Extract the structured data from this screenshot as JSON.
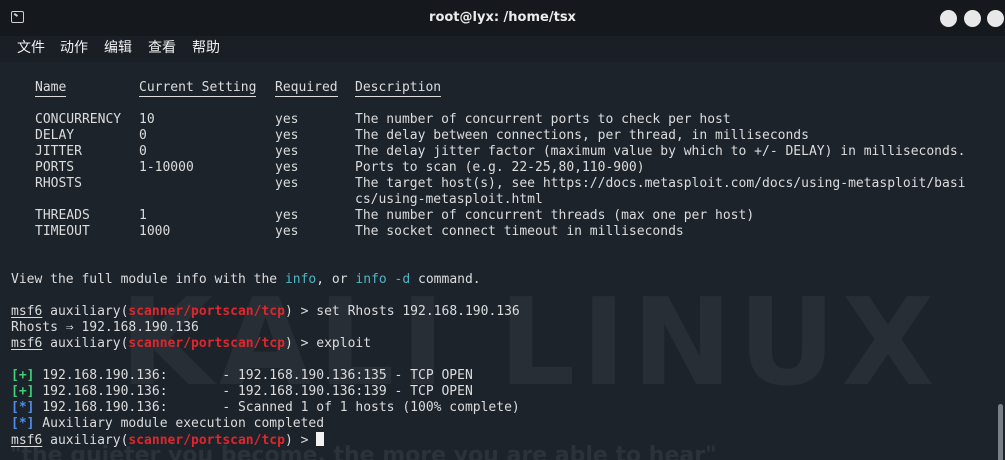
{
  "window": {
    "title": "root@lyx: /home/tsx"
  },
  "menu": [
    "文件",
    "动作",
    "编辑",
    "查看",
    "帮助"
  ],
  "watermark": {
    "big": "KALI LINUX",
    "quote": "\"the quieter you become, the more you are able to hear\""
  },
  "options_table": {
    "headers": [
      "Name",
      "Current Setting",
      "Required",
      "Description"
    ],
    "rows": [
      {
        "name": "CONCURRENCY",
        "setting": "10",
        "required": "yes",
        "description": "The number of concurrent ports to check per host"
      },
      {
        "name": "DELAY",
        "setting": "0",
        "required": "yes",
        "description": "The delay between connections, per thread, in milliseconds"
      },
      {
        "name": "JITTER",
        "setting": "0",
        "required": "yes",
        "description": "The delay jitter factor (maximum value by which to +/- DELAY) in milliseconds."
      },
      {
        "name": "PORTS",
        "setting": "1-10000",
        "required": "yes",
        "description": "Ports to scan (e.g. 22-25,80,110-900)"
      },
      {
        "name": "RHOSTS",
        "setting": "",
        "required": "yes",
        "description": "The target host(s), see https://docs.metasploit.com/docs/using-metasploit/basi",
        "description_cont": "cs/using-metasploit.html"
      },
      {
        "name": "THREADS",
        "setting": "1",
        "required": "yes",
        "description": "The number of concurrent threads (max one per host)"
      },
      {
        "name": "TIMEOUT",
        "setting": "1000",
        "required": "yes",
        "description": "The socket connect timeout in milliseconds"
      }
    ]
  },
  "info_line": {
    "pre": "View the full module info with the ",
    "cmd1": "info",
    "mid": ", or ",
    "cmd2": "info -d",
    "post": " command."
  },
  "prompt": {
    "msf": "msf6",
    "aux": " auxiliary(",
    "module": "scanner/portscan/tcp",
    "end": ") > "
  },
  "commands": [
    "set Rhosts 192.168.190.136",
    "exploit",
    ""
  ],
  "rhosts_echo": "Rhosts ⇒ 192.168.190.136",
  "results": [
    {
      "tag": "[+]",
      "tag_color": "#3fcf7a",
      "text": " 192.168.190.136:       - 192.168.190.136:135 - TCP OPEN"
    },
    {
      "tag": "[+]",
      "tag_color": "#3fcf7a",
      "text": " 192.168.190.136:       - 192.168.190.136:139 - TCP OPEN"
    },
    {
      "tag": "[*]",
      "tag_color": "#4d8fe6",
      "text": " 192.168.190.136:       - Scanned 1 of 1 hosts (100% complete)"
    },
    {
      "tag": "[*]",
      "tag_color": "#4d8fe6",
      "text": " Auxiliary module execution completed"
    }
  ]
}
